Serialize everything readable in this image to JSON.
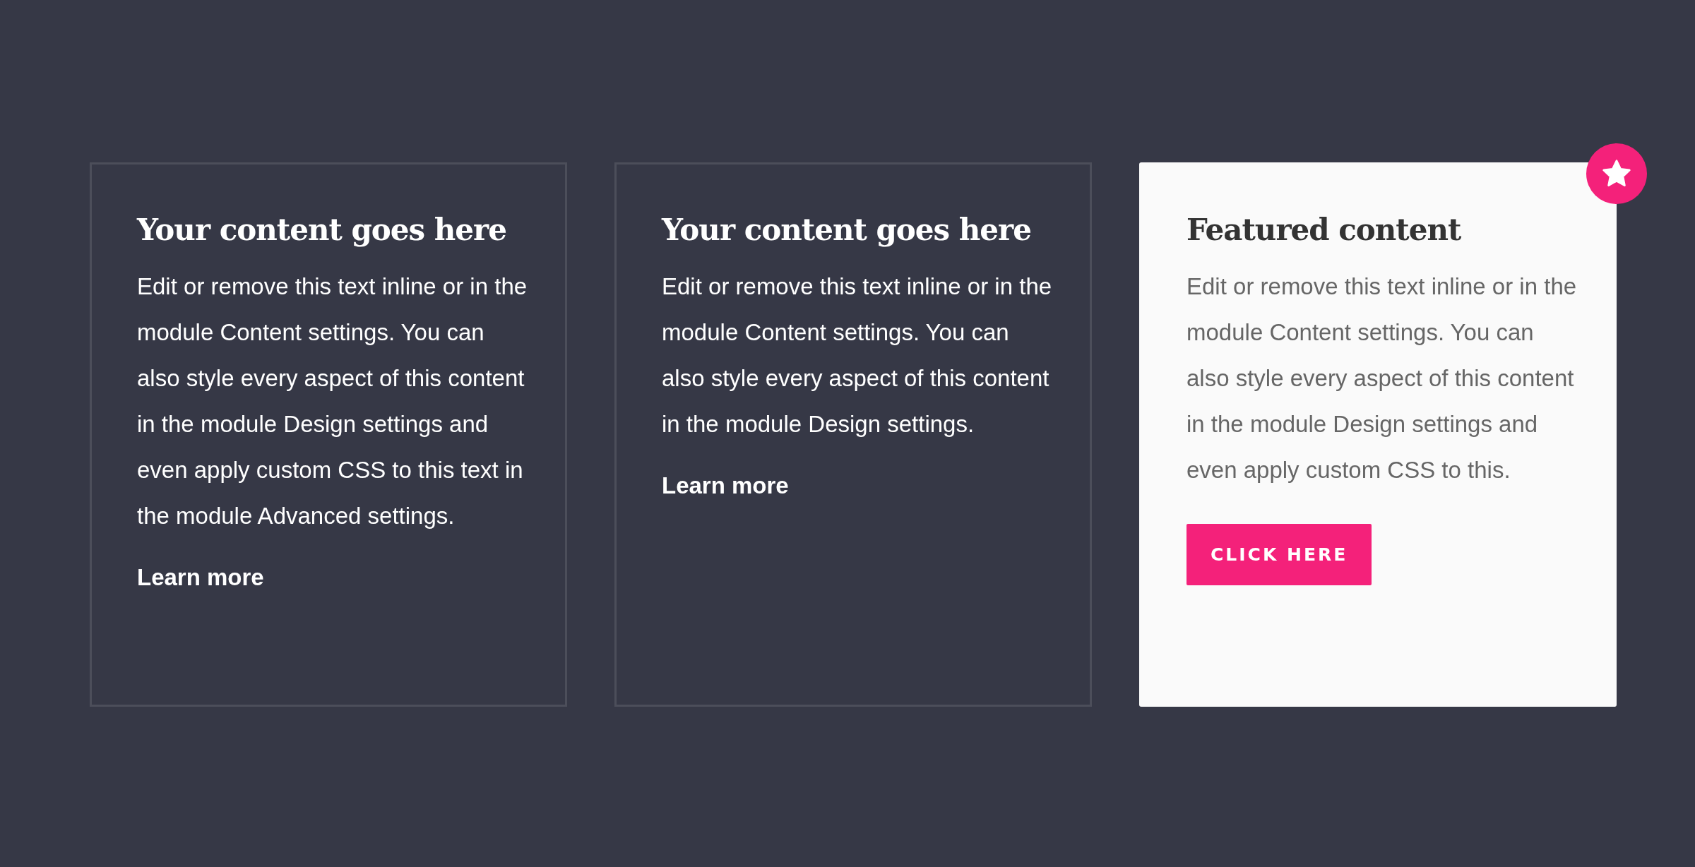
{
  "cards": [
    {
      "kind": "plain",
      "title": "Your content goes here",
      "body": "Edit or remove this text inline or in the module Content settings. You can also style every aspect of this content in the module Design settings and even apply custom CSS to this text in the module Advanced settings.",
      "link": "Learn more"
    },
    {
      "kind": "plain",
      "title": "Your content goes here",
      "body": "Edit or remove this text inline or in the module Content settings. You can also style every aspect of this content in the module Design settings.",
      "link": "Learn more"
    },
    {
      "kind": "featured",
      "title": "Featured content",
      "body": "Edit or remove this text inline or in the module Content settings. You can also style every aspect of this content in the module Design settings and even apply custom CSS to this.",
      "button": "CLICK HERE"
    }
  ]
}
